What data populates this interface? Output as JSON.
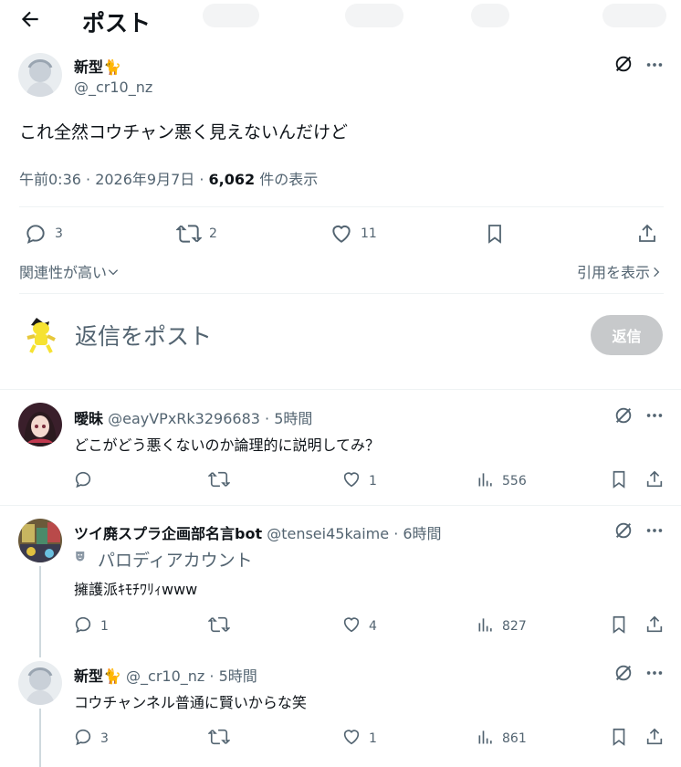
{
  "header": {
    "title": "ポスト"
  },
  "post": {
    "display_name": "新型",
    "name_emoji": "🐈",
    "handle": "@_cr10_nz",
    "text": "これ全然コウチャン悪く見えないんだけど",
    "time": "午前0:36 · 2026年9月7日 · ",
    "views": "6,062",
    "views_label": " 件の表示",
    "replies": "3",
    "reposts": "2",
    "likes": "11"
  },
  "sort": {
    "label": "関連性が高い",
    "quotes_label": "引用を表示"
  },
  "composer": {
    "placeholder": "返信をポスト",
    "button": "返信"
  },
  "replies": [
    {
      "display_name": "曖昧",
      "handle": "@eayVPxRk3296683",
      "time": " · 5時間",
      "text": "どこがどう悪くないのか論理的に説明してみ？",
      "replies": "",
      "likes": "1",
      "views": "556"
    },
    {
      "display_name": "ツイ廃スプラ企画部名言bot",
      "handle": "@tensei45kaime",
      "time": " · 6時間",
      "badge": "パロディアカウント",
      "text": "擁護派ｷﾓﾁﾜﾘｨwww",
      "replies": "1",
      "likes": "4",
      "views": "827"
    },
    {
      "display_name": "新型",
      "name_emoji": "🐈",
      "handle": "@_cr10_nz",
      "time": " · 5時間",
      "text": "コウチャンネル普通に賢いからな笑",
      "replies": "3",
      "likes": "1",
      "views": "861"
    }
  ]
}
